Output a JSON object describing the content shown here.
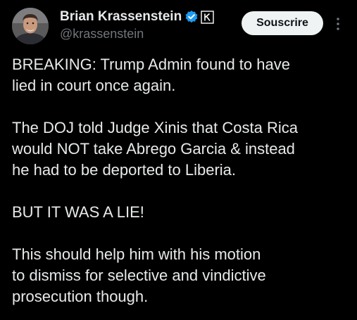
{
  "author": {
    "display_name": "Brian Krassenstein",
    "handle": "@krassenstein",
    "verified": true,
    "avatar": "profile-photo"
  },
  "actions": {
    "subscribe_label": "Souscrire",
    "more_icon": "more-vertical-icon"
  },
  "tweet": {
    "paragraphs": [
      "BREAKING: Trump Admin found to have\nlied in court once again.",
      "The DOJ told Judge Xinis that Costa Rica\nwould NOT take Abrego Garcia & instead\nhe had to be deported to Liberia.",
      "BUT IT WAS A LIE!",
      "This should help him with his motion\nto dismiss for selective and vindictive\nprosecution though."
    ]
  },
  "colors": {
    "background": "#000000",
    "text": "#e7e9ea",
    "secondary_text": "#71767b",
    "verified_badge": "#1d9bf0",
    "button_bg": "#eff3f4",
    "button_text": "#0f1419"
  }
}
